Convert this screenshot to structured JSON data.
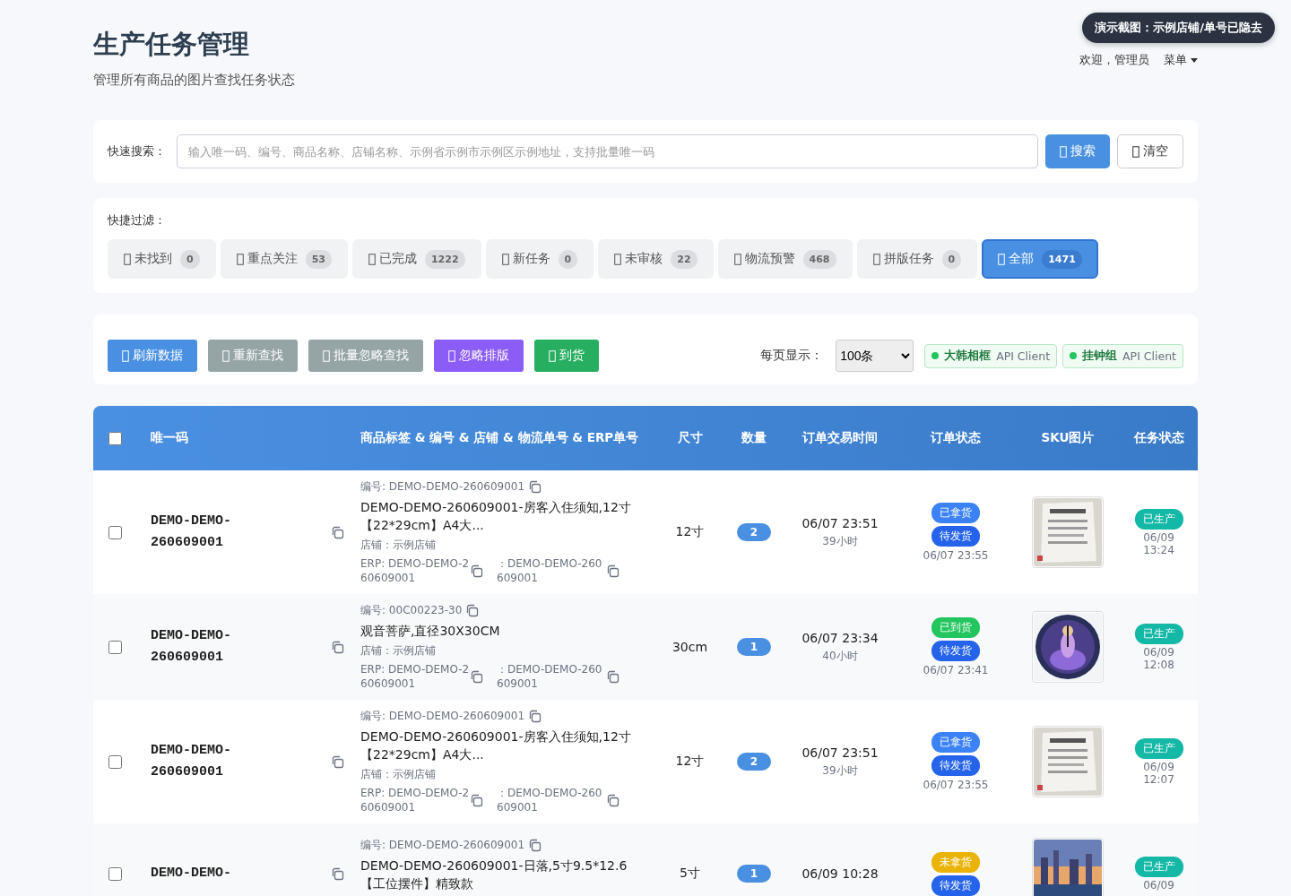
{
  "header": {
    "title": "生产任务管理",
    "subtitle": "管理所有商品的图片查找任务状态",
    "demo_badge": "演示截图：示例店铺/单号已隐去",
    "welcome": "欢迎，管理员",
    "menu": "菜单"
  },
  "search": {
    "label": "快速搜索：",
    "placeholder": "输入唯一码、编号、商品名称、店铺名称、示例省示例市示例区示例地址，支持批量唯一码",
    "buttons": [
      {
        "label": "搜索",
        "kind": "primary"
      },
      {
        "label": "清空",
        "kind": "outline"
      }
    ]
  },
  "filters": {
    "label": "快捷过滤：",
    "items": [
      {
        "label": "未找到",
        "count": "0",
        "selected": false
      },
      {
        "label": "重点关注",
        "count": "53",
        "selected": false
      },
      {
        "label": "已完成",
        "count": "1222",
        "selected": false
      },
      {
        "label": "新任务",
        "count": "0",
        "selected": false
      },
      {
        "label": "未审核",
        "count": "22",
        "selected": false
      },
      {
        "label": "物流预警",
        "count": "468",
        "selected": false
      },
      {
        "label": "拼版任务",
        "count": "0",
        "selected": false
      },
      {
        "label": "全部",
        "count": "1471",
        "selected": true
      }
    ]
  },
  "toolbar": {
    "buttons": [
      {
        "label": "刷新数据",
        "color": "#4a90e2"
      },
      {
        "label": "重新查找",
        "color": "#95a5a6"
      },
      {
        "label": "批量忽略查找",
        "color": "#95a5a6"
      },
      {
        "label": "忽略排版",
        "color": "#8b5cf6"
      },
      {
        "label": "到货",
        "color": "#27ae60"
      }
    ],
    "page_size_label": "每页显示：",
    "page_size": "100条",
    "clients": [
      {
        "name": "大韩相框",
        "suffix": "API Client"
      },
      {
        "name": "挂钟组",
        "suffix": "API Client"
      }
    ]
  },
  "table": {
    "select_all": false,
    "columns": [
      "唯一码",
      "商品标签 & 编号 & 店铺 & 物流单号 & ERP单号",
      "尺寸",
      "数量",
      "订单交易时间",
      "订单状态",
      "SKU图片",
      "任务状态"
    ],
    "rows": [
      {
        "checked": false,
        "code": [
          "DEMO-DEMO-",
          "260609001"
        ],
        "number": "编号: DEMO-DEMO-260609001",
        "name": "DEMO-DEMO-260609001-房客入住须知,12寸【22*29cm】A4大...",
        "store": "店铺：示例店铺",
        "erp": "ERP: DEMO-DEMO-260609001",
        "logistics": "：DEMO-DEMO-260609001",
        "size": "12寸",
        "qty": "2",
        "time": "06/07 23:51",
        "age": "39小时",
        "order_status": [
          {
            "label": "已拿货",
            "color": "#3b82f6"
          },
          {
            "label": "待发货",
            "color": "#2563eb"
          }
        ],
        "status_time": "06/07 23:55",
        "picture": {
          "kind": "picture"
        },
        "task_status": "已生产",
        "task_time": "06/09 13:24"
      },
      {
        "checked": false,
        "code": [
          "DEMO-DEMO-",
          "260609001"
        ],
        "number": "编号: 00C00223-30",
        "name": "观音菩萨,直径30X30CM",
        "store": "店铺：示例店铺",
        "erp": "ERP: DEMO-DEMO-260609001",
        "logistics": "：DEMO-DEMO-260609001",
        "size": "30cm",
        "qty": "1",
        "time": "06/07 23:34",
        "age": "40小时",
        "order_status": [
          {
            "label": "已到货",
            "color": "#22c55e"
          },
          {
            "label": "待发货",
            "color": "#2563eb"
          }
        ],
        "status_time": "06/07 23:41",
        "picture": {
          "kind": "picture"
        },
        "task_status": "已生产",
        "task_time": "06/09 12:08"
      },
      {
        "checked": false,
        "code": [
          "DEMO-DEMO-",
          "260609001"
        ],
        "number": "编号: DEMO-DEMO-260609001",
        "name": "DEMO-DEMO-260609001-房客入住须知,12寸【22*29cm】A4大...",
        "store": "店铺：示例店铺",
        "erp": "ERP: DEMO-DEMO-260609001",
        "logistics": "：DEMO-DEMO-260609001",
        "size": "12寸",
        "qty": "2",
        "time": "06/07 23:51",
        "age": "39小时",
        "order_status": [
          {
            "label": "已拿货",
            "color": "#3b82f6"
          },
          {
            "label": "待发货",
            "color": "#2563eb"
          }
        ],
        "status_time": "06/07 23:55",
        "picture": {
          "kind": "picture"
        },
        "task_status": "已生产",
        "task_time": "06/09 12:07"
      },
      {
        "checked": false,
        "code": [
          "DEMO-DEMO-"
        ],
        "number": "编号: DEMO-DEMO-260609001",
        "name": "DEMO-DEMO-260609001-日落,5寸9.5*12.6【工位摆件】精致款",
        "size": "5寸",
        "qty": "1",
        "time": "06/09 10:28",
        "order_status": [
          {
            "label": "未拿货",
            "color": "#eab308"
          },
          {
            "label": "待发货",
            "color": "#2563eb"
          }
        ],
        "picture": {
          "kind": "picture"
        },
        "task_status": "已生产",
        "task_time": "06/09"
      }
    ]
  }
}
